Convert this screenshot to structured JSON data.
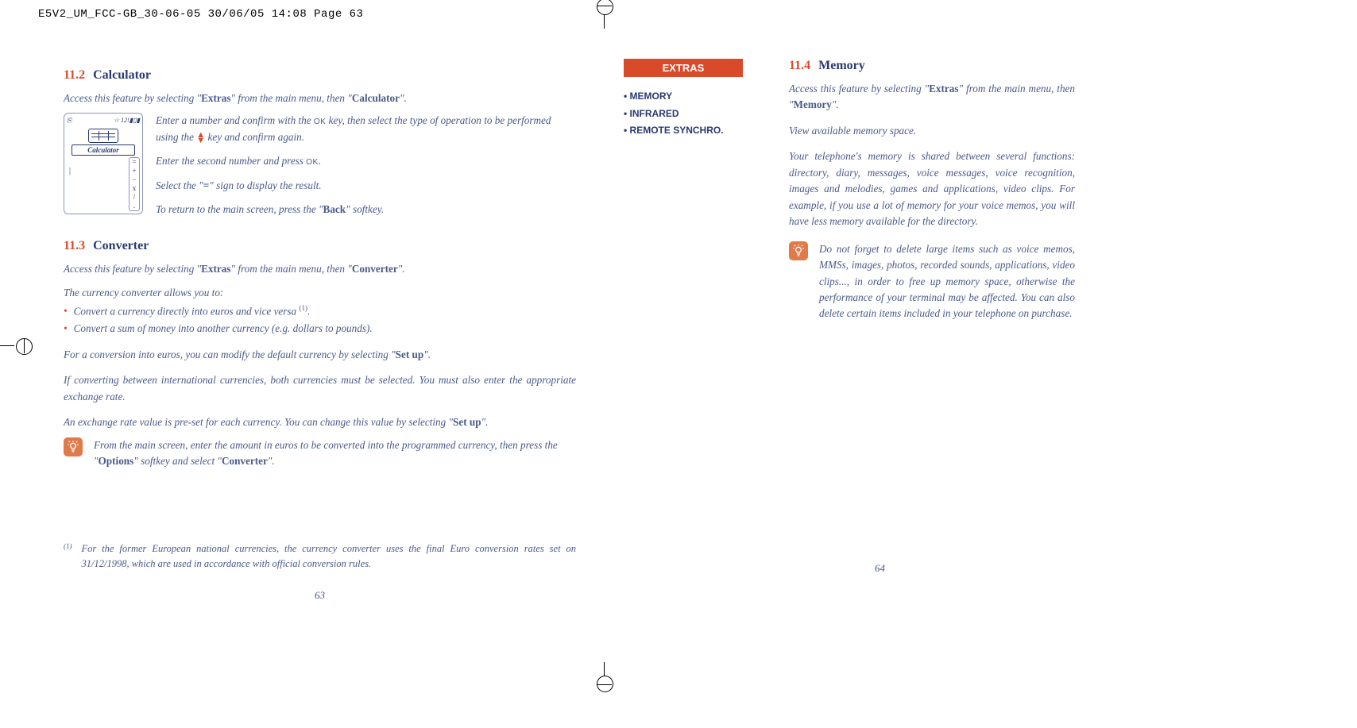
{
  "print_header": "E5V2_UM_FCC-GB_30-06-05  30/06/05  14:08  Page 63",
  "left": {
    "s112_num": "11.2",
    "s112_title": "Calculator",
    "s112_intro_a": "Access this feature by selecting \"",
    "s112_intro_b": "Extras",
    "s112_intro_c": "\" from the main menu, then \"",
    "s112_intro_d": "Calculator",
    "s112_intro_e": "\".",
    "calc_l1_a": "Enter a number and confirm with the ",
    "calc_l1_ok": "OK",
    "calc_l1_b": " key, then select the type of operation to be performed using the ",
    "calc_l1_c": " key and confirm again.",
    "calc_l2_a": "Enter the second number and press ",
    "calc_l2_ok": "OK",
    "calc_l2_b": ".",
    "calc_l3_a": "Select the \"",
    "calc_l3_eq": "=",
    "calc_l3_b": "\" sign to display the result.",
    "calc_l4_a": "To return to the main screen, press the \"",
    "calc_l4_b": "Back",
    "calc_l4_c": "\" softkey.",
    "phone_label": "Calculator",
    "phone_status_left": "⎘",
    "phone_status_right": "☆ 12!▮▯▮",
    "s113_num": "11.3",
    "s113_title": "Converter",
    "s113_intro_a": "Access this feature by selecting \"",
    "s113_intro_b": "Extras",
    "s113_intro_c": "\" from the main menu, then \"",
    "s113_intro_d": "Converter",
    "s113_intro_e": "\".",
    "conv_lead": "The currency converter allows you to:",
    "conv_b1": "Convert a currency directly into euros and vice versa ",
    "conv_b1_sup": "(1)",
    "conv_b1_end": ".",
    "conv_b2": "Convert a sum of money into another currency (e.g. dollars to pounds).",
    "conv_p1_a": "For a conversion into euros, you can modify the default currency by selecting \"",
    "conv_p1_b": "Set up",
    "conv_p1_c": "\".",
    "conv_p2": "If converting between international currencies, both currencies must be selected. You must also enter the appropriate exchange rate.",
    "conv_p3_a": "An exchange rate value is pre-set for each currency. You can change this value by selecting \"",
    "conv_p3_b": "Set up",
    "conv_p3_c": "\".",
    "tip_a": "From the main screen, enter the amount in euros to be converted into the programmed currency, then press the \"",
    "tip_b": "Options",
    "tip_c": "\" softkey and select \"",
    "tip_d": "Converter",
    "tip_e": "\".",
    "fn_mark": "(1)",
    "fn_text": "For the former European national currencies, the currency converter uses the final Euro conversion rates set on 31/12/1998, which are used in accordance with official conversion rules.",
    "page_num": "63"
  },
  "right": {
    "extras_title": "EXTRAS",
    "extras_items": [
      "MEMORY",
      "INFRARED",
      "REMOTE SYNCHRO."
    ],
    "s114_num": "11.4",
    "s114_title": "Memory",
    "mem_intro_a": "Access this feature by selecting \"",
    "mem_intro_b": "Extras",
    "mem_intro_c": "\" from the main menu, then \"",
    "mem_intro_d": "Memory",
    "mem_intro_e": "\".",
    "mem_p1": "View available memory space.",
    "mem_p2": "Your telephone's memory is shared between several functions: directory, diary, messages, voice messages, voice recognition, images and melodies, games and applications, video clips. For example, if you use a lot of memory for your voice memos, you will have less memory available for the directory.",
    "mem_tip": "Do not forget to delete large items such as voice memos, MMSs, images, photos, recorded sounds, applications, video clips..., in order to free up memory space, otherwise the performance of your terminal may be affected. You can also delete certain items included in your telephone on purchase.",
    "page_num": "64"
  }
}
